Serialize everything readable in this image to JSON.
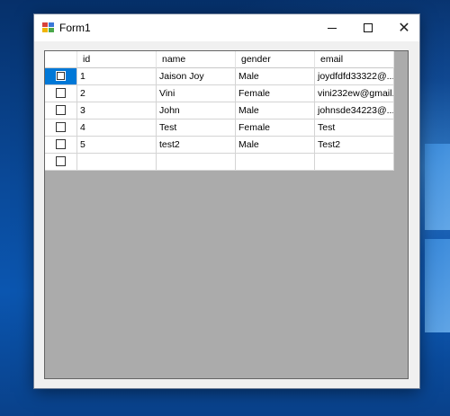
{
  "window": {
    "title": "Form1",
    "minimize_glyph": "—",
    "maximize_glyph": "☐",
    "close_glyph": "✕"
  },
  "grid": {
    "columns": [
      "",
      "id",
      "name",
      "gender",
      "email"
    ],
    "rows": [
      {
        "checked": false,
        "id": "1",
        "name": "Jaison Joy",
        "gender": "Male",
        "email": "joydfdfd33322@..."
      },
      {
        "checked": false,
        "id": "2",
        "name": "Vini",
        "gender": "Female",
        "email": "vini232ew@gmail..."
      },
      {
        "checked": false,
        "id": "3",
        "name": "John",
        "gender": "Male",
        "email": "johnsde34223@..."
      },
      {
        "checked": false,
        "id": "4",
        "name": "Test",
        "gender": "Female",
        "email": "Test"
      },
      {
        "checked": false,
        "id": "5",
        "name": "test2",
        "gender": "Male",
        "email": "Test2"
      },
      {
        "checked": false,
        "id": "",
        "name": "",
        "gender": "",
        "email": ""
      }
    ],
    "selected_row_index": 0
  },
  "colors": {
    "selection": "#0078d7",
    "grid_background": "#ababab",
    "desktop_blue": "#0b56b0"
  }
}
